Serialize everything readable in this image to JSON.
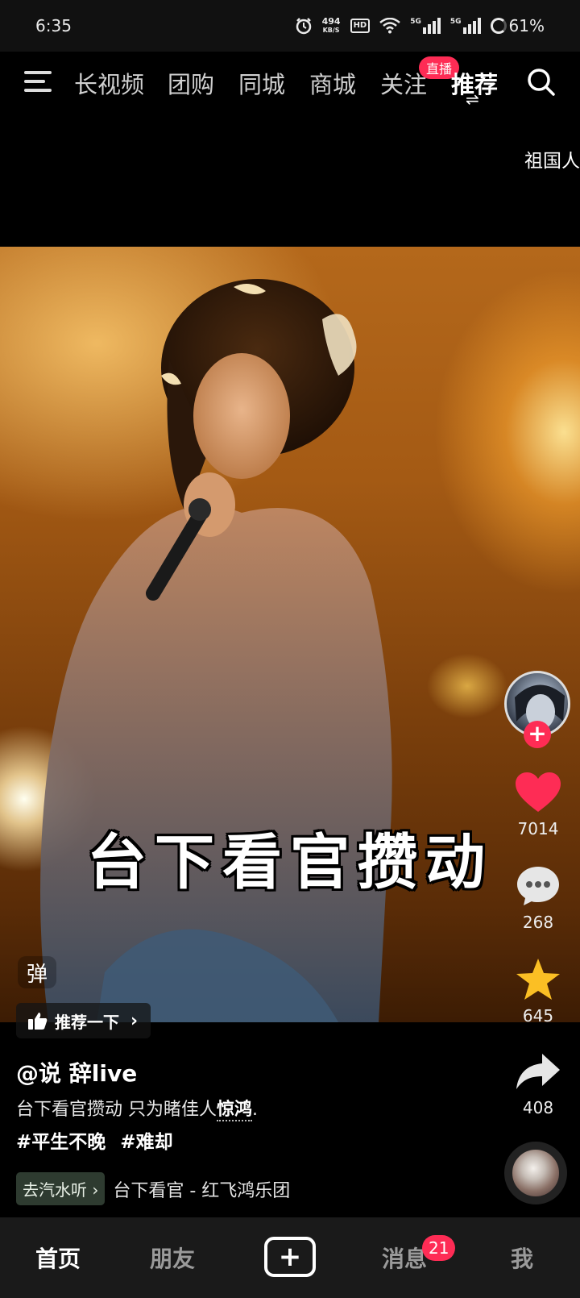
{
  "status_bar": {
    "time": "6:35",
    "net_speed": "494",
    "net_unit": "KB/S",
    "hd_label": "HD",
    "signal1_label": "5G",
    "signal2_label": "5G",
    "battery": "61%"
  },
  "top_nav": {
    "tabs": [
      {
        "label": "长视频"
      },
      {
        "label": "团购"
      },
      {
        "label": "同城"
      },
      {
        "label": "商城"
      },
      {
        "label": "关注"
      },
      {
        "label": "推荐"
      }
    ],
    "active_tab": "推荐",
    "live_badge": "直播",
    "side_peek_text": "祖国人"
  },
  "video": {
    "subtitle": "台下看官攒动",
    "danmaku_label": "弹",
    "recommend_label": "推荐一下"
  },
  "actions": {
    "likes": "7014",
    "comments": "268",
    "favorites": "645",
    "shares": "408"
  },
  "caption": {
    "author": "@说 辞live",
    "desc_prefix": "台下看官攒动 只为睹佳人",
    "desc_keyword": "惊鸿",
    "desc_suffix": ".",
    "tags": [
      "#平生不晚",
      "#难却"
    ]
  },
  "music": {
    "chip_label": "去汽水听",
    "track": "台下看官 - 红飞鸿乐团"
  },
  "bottom_nav": {
    "home": "首页",
    "friends": "朋友",
    "messages": "消息",
    "messages_badge": "21",
    "me": "我"
  },
  "colors": {
    "accent": "#fe2c55",
    "like": "#fe2c55",
    "favorite": "#fbbf24",
    "music_chip_bg": "#2e3b30"
  }
}
